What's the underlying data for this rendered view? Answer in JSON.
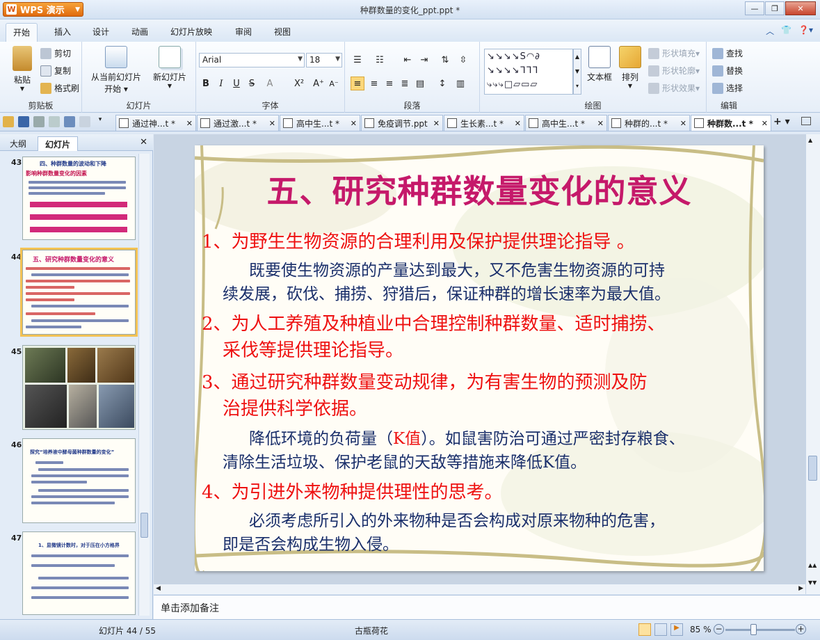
{
  "app": {
    "name": "WPS 演示",
    "doc_title": "种群数量的变化_ppt.ppt *"
  },
  "menu": {
    "tabs": [
      "开始",
      "插入",
      "设计",
      "动画",
      "幻灯片放映",
      "审阅",
      "视图"
    ]
  },
  "ribbon": {
    "clipboard": {
      "paste": "粘贴",
      "cut": "剪切",
      "copy": "复制",
      "format_painter": "格式刷",
      "label": "剪贴板"
    },
    "slides": {
      "from_current": "从当前幻灯片",
      "start": "开始",
      "new_slide": "新幻灯片",
      "label": "幻灯片"
    },
    "font": {
      "name": "Arial",
      "size": "18",
      "label": "字体",
      "bold": "B",
      "italic": "I",
      "underline": "U",
      "strike": "S"
    },
    "paragraph": {
      "label": "段落"
    },
    "drawing": {
      "textbox": "文本框",
      "arrange": "排列",
      "fill": "形状填充",
      "outline": "形状轮廓",
      "effect": "形状效果",
      "label": "绘图"
    },
    "editing": {
      "find": "查找",
      "replace": "替换",
      "select": "选择",
      "label": "编辑"
    }
  },
  "doc_tabs": [
    "通过神...t *",
    "通过激...t *",
    "高中生...t *",
    "免疫调节.ppt",
    "生长素...t *",
    "高中生...t *",
    "种群的...t *",
    "种群数...t *"
  ],
  "left_panel": {
    "tab_outline": "大纲",
    "tab_slides": "幻灯片",
    "thumb_numbers": [
      "43",
      "44",
      "45",
      "46",
      "47"
    ]
  },
  "thumbs": {
    "t43_title": "四、种群数量的波动和下降",
    "t43_sub": "影响种群数量变化的因素",
    "t44_title": "五、研究种群数量变化的意义",
    "t46_title": "探究“培养液中酵母菌种群数量的变化”",
    "t47_line": "1、显微镜计数时，对于压在小方格界"
  },
  "slide": {
    "title": "五、研究种群数量变化的意义",
    "p1": "1、为野生生物资源的合理利用及保护提供理论指导 。",
    "p1_desc_a": "既要使生物资源的产量达到最大，又不危害生物资源的可持",
    "p1_desc_b": "续发展，砍伐、捕捞、狩猎后，保证种群的增长速率为最大值。",
    "p2_a": "2、为人工养殖及种植业中合理控制种群数量、适时捕捞、",
    "p2_b": "采伐等提供理论指导。",
    "p3_a": "3、通过研究种群数量变动规律，为有害生物的预测及防",
    "p3_b": "治提供科学依据。",
    "p3_desc_a1": "降低环境的负荷量（",
    "p3_desc_k": "K值",
    "p3_desc_a2": "）。如鼠害防治可通过严密封存粮食、",
    "p3_desc_b": "清除生活垃圾、保护老鼠的天敌等措施来降低K值。",
    "p4": "4、为引进外来物种提供理性的思考。",
    "p4_desc_a": "必须考虑所引入的外来物种是否会构成对原来物种的危害，",
    "p4_desc_b": "即是否会构成生物入侵。"
  },
  "notes": "单击添加备注",
  "status": {
    "slide_pos": "幻灯片 44 / 55",
    "theme": "古瓶荷花",
    "zoom": "85 %"
  },
  "colors": {
    "title": "#c5196a",
    "heading": "#ee1111",
    "body": "#1a2f6b"
  }
}
